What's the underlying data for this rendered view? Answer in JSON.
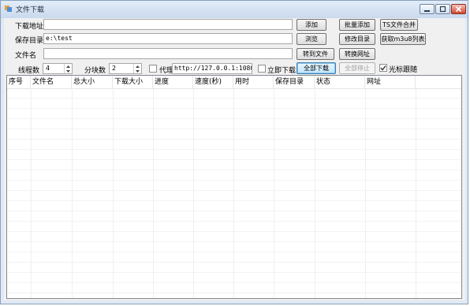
{
  "window": {
    "title": "文件下载"
  },
  "form": {
    "download_url": {
      "label": "下载地址",
      "value": ""
    },
    "save_dir": {
      "label": "保存目录",
      "value": "e:\\test"
    },
    "file_name": {
      "label": "文件名",
      "value": ""
    },
    "threads": {
      "label": "线程数",
      "value": "4"
    },
    "blocks": {
      "label": "分块数",
      "value": "2"
    },
    "proxy": {
      "label": "代理",
      "checked": false,
      "value": "http://127.0.0.1:1080"
    },
    "instant_download": {
      "label": "立即下载",
      "checked": false
    },
    "cursor_follow": {
      "label": "光标跟随",
      "checked": true
    }
  },
  "buttons": {
    "add": "添加",
    "batch_add": "批量添加",
    "ts_merge": "TS文件合并",
    "browse": "浏览",
    "change_dir": "修改目录",
    "get_m3u8": "获取m3u8列表",
    "to_file": "转到文件",
    "convert_url": "转换网址",
    "download_all": "全部下载",
    "stop_all": "全部停止"
  },
  "table": {
    "columns": [
      "序号",
      "文件名",
      "总大小",
      "下载大小",
      "进度",
      "速度(秒)",
      "用时",
      "保存目录",
      "状态",
      "网址"
    ],
    "rows": []
  }
}
